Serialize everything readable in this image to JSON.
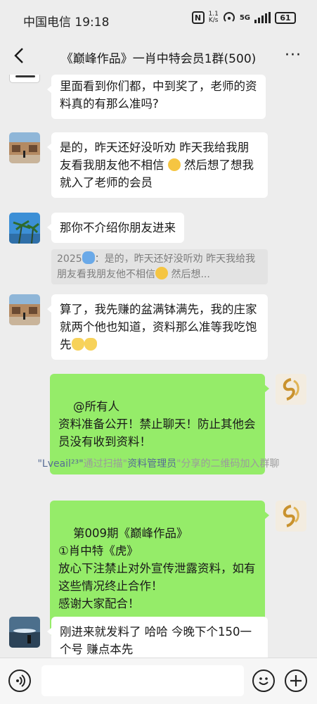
{
  "status_bar": {
    "carrier_time": "中国电信 19:18",
    "nfc_label": "N",
    "speed_top": "1.1",
    "speed_bottom": "K/s",
    "network": "5G",
    "battery": "61"
  },
  "nav": {
    "title": "《巅峰作品》一肖中特会员1群(500)",
    "more": "···"
  },
  "messages": [
    {
      "side": "left",
      "text": "里面看到你们都，中到奖了，老师的资料真的有那么准吗?"
    },
    {
      "side": "left",
      "text": "是的，昨天还好没听劝 昨天我给我朋友看我朋友他不相信",
      "text_after": " 然后想了想我就入了老师的会员"
    },
    {
      "side": "left",
      "text": "那你不介绍你朋友进来"
    },
    {
      "type": "quote",
      "text": "2025",
      "text_after": "：是的，昨天还好没听劝 昨天我给我朋友看我朋友他不相信",
      "text_end": " 然后想..."
    },
    {
      "side": "left",
      "text": "算了，我先赚的盆满钵满先，我的庄家就两个他也知道，资料那么准等我吃饱先"
    },
    {
      "side": "right",
      "text": "@所有人\n资料准备公开！禁止聊天！防止其他会员没有收到资料！"
    },
    {
      "type": "system",
      "part1": "\"Lveail²³\"",
      "part2": "通过扫描\"",
      "part3": "资料管理员",
      "part4": "\"分享的二维码加入群聊"
    },
    {
      "side": "right",
      "text": "第009期《巅峰作品》\n①肖中特《虎》\n放心下注禁止对外宣传泄露资料，如有这些情况终止合作！\n感谢大家配合！"
    },
    {
      "side": "left",
      "text": "刚进来就发料了 哈哈 今晚下个150一个号 赚点本先"
    }
  ],
  "colors": {
    "background": "#ededed",
    "bubble_green": "#95ec69",
    "bubble_white": "#ffffff",
    "link_blue": "#576b95"
  },
  "icons": [
    "back-arrow-icon",
    "more-icon",
    "voice-icon",
    "emoji-icon",
    "plus-icon",
    "fish-emoji-icon",
    "sweat-emoji-icon",
    "cat-emoji-icon"
  ]
}
